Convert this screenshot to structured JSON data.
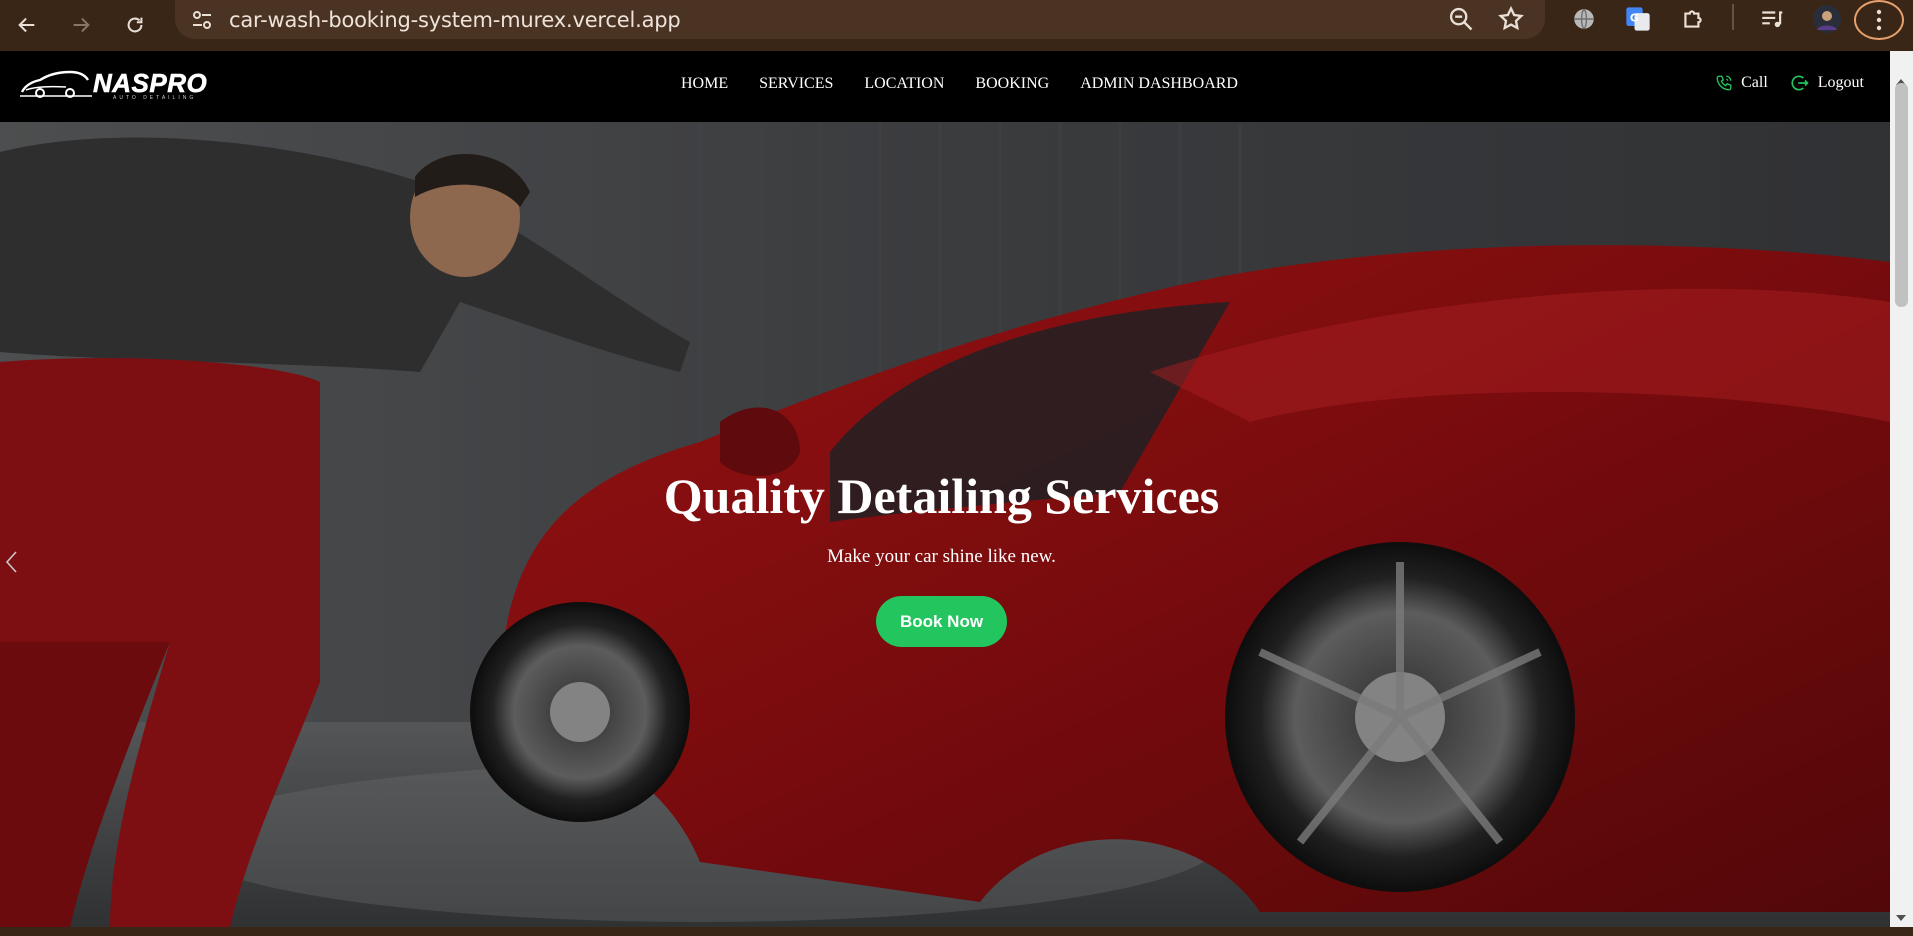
{
  "browser": {
    "url": "car-wash-booking-system-murex.vercel.app",
    "back_icon": "arrow-left-icon",
    "forward_icon": "arrow-right-icon",
    "reload_icon": "reload-icon",
    "site_info_icon": "tune-icon",
    "zoom_icon": "zoom-out-icon",
    "bookmark_icon": "star-icon",
    "accent_ring_color": "#e8a06b"
  },
  "site": {
    "logo": {
      "brand": "NASPRO",
      "tagline": "AUTO DETAILING"
    },
    "nav": [
      {
        "label": "HOME"
      },
      {
        "label": "SERVICES"
      },
      {
        "label": "LOCATION"
      },
      {
        "label": "BOOKING"
      },
      {
        "label": "ADMIN DASHBOARD"
      }
    ],
    "actions": {
      "call_label": "Call",
      "logout_label": "Logout",
      "icon_color": "#22c55e"
    }
  },
  "hero": {
    "title": "Quality Detailing Services",
    "subtitle": "Make your car shine like new.",
    "cta_label": "Book Now",
    "cta_color": "#22c55e"
  }
}
